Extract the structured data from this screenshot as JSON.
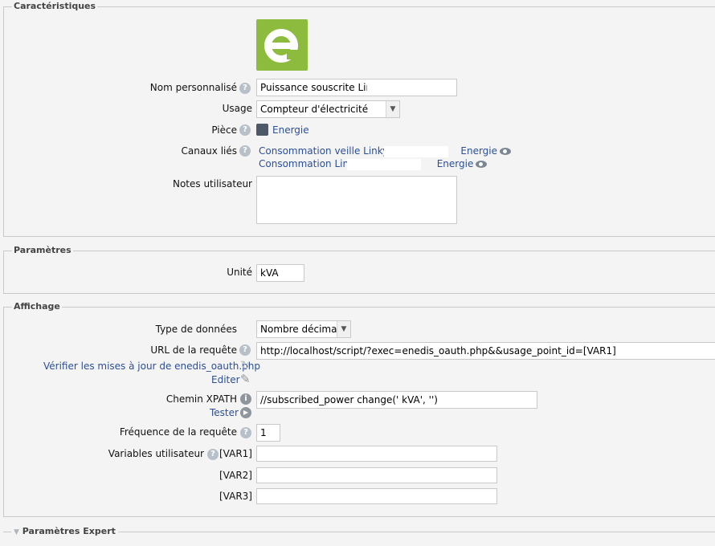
{
  "caracteristiques": {
    "legend": "Caractéristiques",
    "nom_label": "Nom personnalisé",
    "nom_value": "Puissance souscrite Linky",
    "usage_label": "Usage",
    "usage_value": "Compteur d'électricité",
    "piece_label": "Pièce",
    "piece_value": "Energie",
    "canaux_label": "Canaux liés",
    "canaux": [
      {
        "prefix": "Consommation veille Linky",
        "suffix": "Energie"
      },
      {
        "prefix": "Consommation Linky",
        "suffix": "Energie"
      }
    ],
    "notes_label": "Notes utilisateur",
    "notes_value": ""
  },
  "parametres": {
    "legend": "Paramètres",
    "unite_label": "Unité",
    "unite_value": "kVA"
  },
  "affichage": {
    "legend": "Affichage",
    "type_label": "Type de données",
    "type_value": "Nombre décimal",
    "url_label": "URL de la requête",
    "url_value": "http://localhost/script/?exec=enedis_oauth.php&&usage_point_id=[VAR1]",
    "verifier_link": "Vérifier les mises à jour de enedis_oauth.php",
    "editer_link": "Editer",
    "xpath_label": "Chemin XPATH",
    "xpath_value": "//subscribed_power change(' kVA', '')",
    "tester_link": "Tester",
    "freq_label": "Fréquence de la requête",
    "freq_value": "1",
    "vars_label": "Variables utilisateur",
    "var1_label": "[VAR1]",
    "var2_label": "[VAR2]",
    "var3_label": "[VAR3]",
    "var1_value": "",
    "var2_value": "",
    "var3_value": ""
  },
  "expert": {
    "legend": "Paramètres Expert"
  },
  "icons": {
    "help": "?",
    "info": "i",
    "dropdown": "▼",
    "expand": "▼",
    "refresh": "↻",
    "edit": "✎",
    "play": "▶"
  },
  "colors": {
    "link": "#2b4f9a",
    "logo_green": "#8dbb3e"
  }
}
